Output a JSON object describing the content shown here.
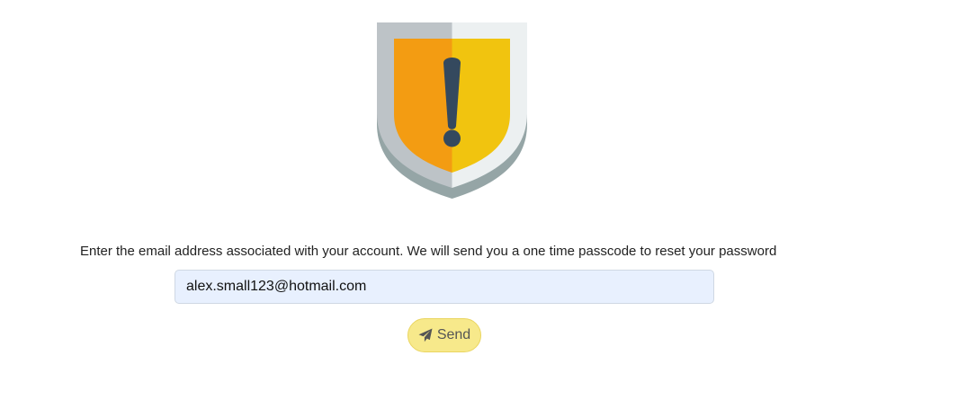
{
  "form": {
    "instruction": "Enter the email address associated with your account. We will send you a one time passcode to reset your password",
    "email_value": "alex.small123@hotmail.com",
    "send_label": "Send"
  },
  "icons": {
    "hero": "shield-warning-icon",
    "send": "paper-plane-icon"
  },
  "colors": {
    "shield_left_orange": "#f39c12",
    "shield_right_yellow": "#f1c40f",
    "shield_frame_left": "#bdc3c7",
    "shield_frame_right": "#ecf0f1",
    "exclamation": "#34495e",
    "input_background": "#e8f0fe",
    "button_background": "#f7e98b"
  }
}
